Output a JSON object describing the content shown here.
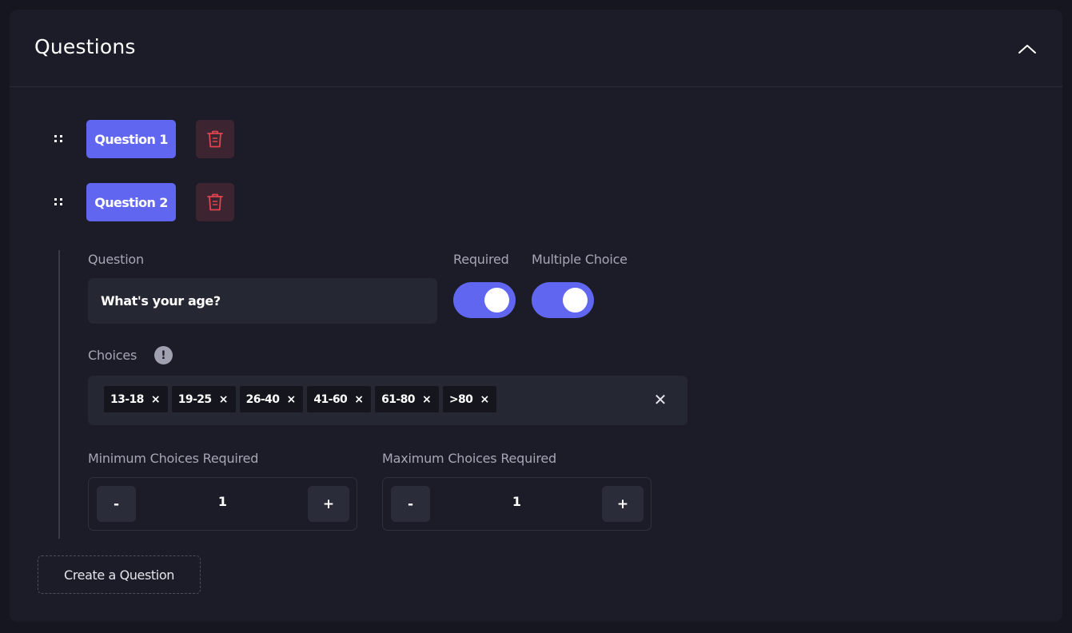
{
  "panel": {
    "title": "Questions"
  },
  "questions": [
    {
      "label": "Question 1"
    },
    {
      "label": "Question 2"
    }
  ],
  "editor": {
    "question_label": "Question",
    "question_value": "What's your age?",
    "required_label": "Required",
    "required_on": true,
    "multiple_choice_label": "Multiple Choice",
    "multiple_choice_on": true,
    "choices_label": "Choices",
    "info_glyph": "!",
    "choices": [
      "13-18",
      "19-25",
      "26-40",
      "41-60",
      "61-80",
      ">80"
    ],
    "chip_remove_glyph": "×",
    "clear_all_glyph": "✕",
    "min_label": "Minimum Choices Required",
    "min_value": "1",
    "max_label": "Maximum Choices Required",
    "max_value": "1",
    "minus": "-",
    "plus": "+"
  },
  "footer": {
    "create_label": "Create a Question"
  },
  "colors": {
    "accent": "#6166f0",
    "delete_icon": "#e0454f",
    "panel_bg": "#1b1c27"
  }
}
